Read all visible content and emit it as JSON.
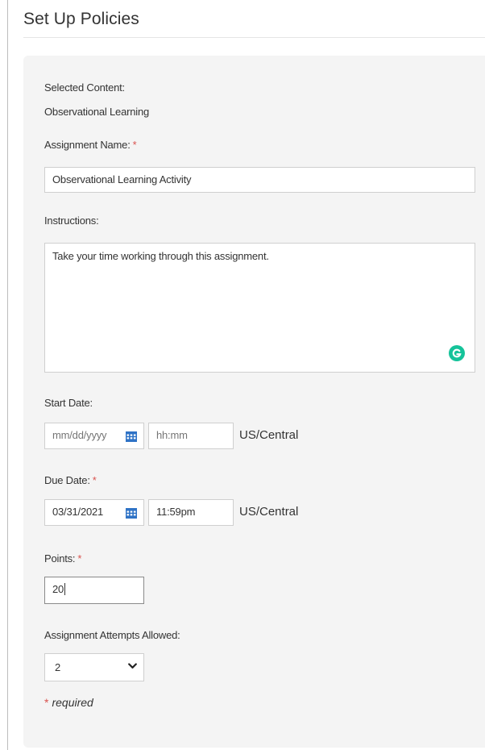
{
  "page": {
    "title": "Set Up Policies"
  },
  "form": {
    "selected_content_label": "Selected Content:",
    "selected_content_value": "Observational Learning",
    "assignment_name": {
      "label": "Assignment Name:",
      "required_marker": "*",
      "value": "Observational Learning Activity"
    },
    "instructions": {
      "label": "Instructions:",
      "value": "Take your time working through this assignment."
    },
    "start_date": {
      "label": "Start Date:",
      "date_placeholder": "mm/dd/yyyy",
      "time_placeholder": "hh:mm",
      "timezone": "US/Central"
    },
    "due_date": {
      "label": "Due Date:",
      "required_marker": "*",
      "date_value": "03/31/2021",
      "time_value": "11:59pm",
      "timezone": "US/Central"
    },
    "points": {
      "label": "Points:",
      "required_marker": "*",
      "value": "20"
    },
    "attempts": {
      "label": "Assignment Attempts Allowed:",
      "selected": "2"
    },
    "required_note": {
      "marker": "*",
      "text": "required"
    }
  },
  "icons": {
    "calendar": "calendar-icon",
    "chevron": "chevron-down-icon",
    "grammarly": "grammarly-icon"
  },
  "colors": {
    "required": "#d9534f",
    "calendar_icon": "#2f73c6",
    "grammarly": "#15c39a",
    "panel_bg": "#f4f4f4"
  }
}
